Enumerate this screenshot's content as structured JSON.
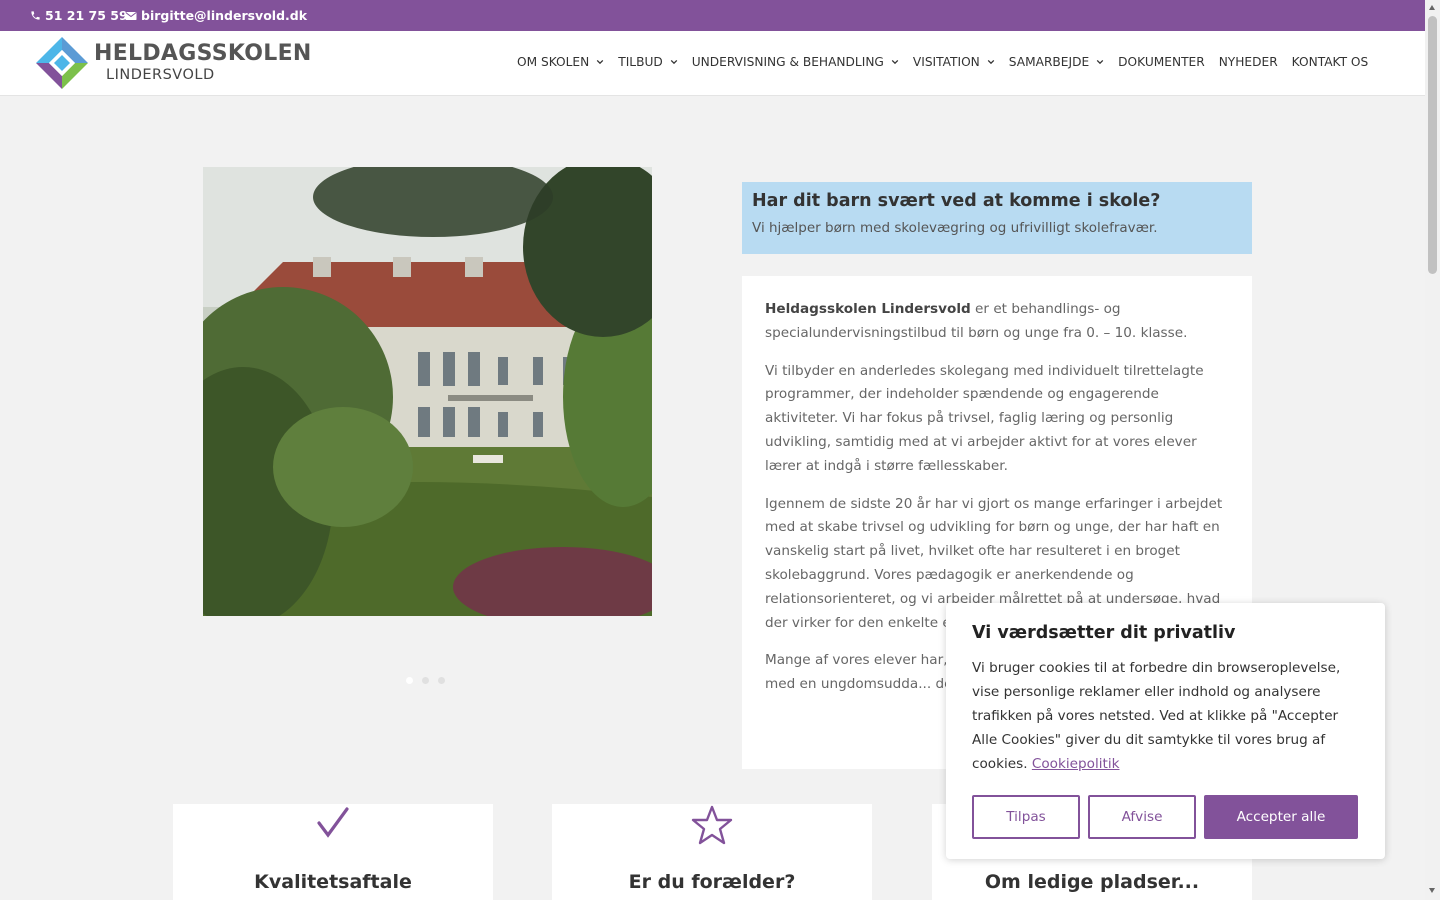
{
  "topbar": {
    "phone": "51 21 75 59",
    "email": "birgitte@lindersvold.dk",
    "phone_icon": "phone-icon",
    "email_icon": "envelope-icon",
    "background": "#82529a"
  },
  "header": {
    "logo_title": "HELDAGSSKOLEN",
    "logo_subtitle": "LINDERSVOLD",
    "logo_icon": "diamond-logo-icon",
    "nav": [
      {
        "label": "OM SKOLEN",
        "dropdown": true
      },
      {
        "label": "TILBUD",
        "dropdown": true
      },
      {
        "label": "UNDERVISNING & BEHANDLING",
        "dropdown": true
      },
      {
        "label": "VISITATION",
        "dropdown": true
      },
      {
        "label": "SAMARBEJDE",
        "dropdown": true
      },
      {
        "label": "DOKUMENTER",
        "dropdown": false
      },
      {
        "label": "NYHEDER",
        "dropdown": false
      },
      {
        "label": "KONTAKT OS",
        "dropdown": false
      }
    ]
  },
  "slider": {
    "image": "manor-building-photo",
    "dots": 3,
    "active_dot": 1
  },
  "banner": {
    "title": "Har dit barn svært ved at komme i skole?",
    "subtitle": "Vi hjælper børn med skolevægring og ufrivilligt skolefravær.",
    "background": "#b8dbf2"
  },
  "intro": {
    "p1_strong": "Heldagsskolen Lindersvold",
    "p1_rest": " er et behandlings- og specialundervisningstilbud til børn og unge fra 0. – 10. klasse.",
    "p2": "Vi tilbyder en anderledes skolegang med individuelt tilrettelagte programmer, der indeholder spændende og engagerende aktiviteter. Vi har fokus på trivsel, faglig læring og personlig udvikling, samtidig med at vi arbejder aktivt for at vores elever lærer at indgå i større fællesskaber.",
    "p3": "Igennem de sidste 20 år har vi gjort os mange erfaringer i arbejdet med at skabe trivsel og udvikling for børn og unge, der har haft en vanskelig start på livet, hvilket ofte har resulteret i en broget skolebaggrund. Vores pædagogik er anerkendende og relationsorienteret, og vi arbejder målrettet på at undersøge, hvad der virker for den enkelte elev.",
    "p4": "Mange af vores elever har, g... fået taget deres 9. klasses a... gang med en ungdomsudda... dem, når de skal skabe sig e..."
  },
  "cards": [
    {
      "title": "Kvalitetsaftale",
      "icon": "checkmark-icon"
    },
    {
      "title": "Er du forælder?",
      "icon": "star-icon"
    },
    {
      "title": "Om ledige pladser...",
      "icon": ""
    }
  ],
  "cookie": {
    "title": "Vi værdsætter dit privatliv",
    "message": "Vi bruger cookies til at forbedre din browseroplevelse, vise personlige reklamer eller indhold og analysere trafikken på vores netsted. Ved at klikke på \"Accepter Alle Cookies\" giver du dit samtykke til vores brug af cookies.",
    "link": "Cookiepolitik",
    "btn_customize": "Tilpas",
    "btn_reject": "Afvise",
    "btn_accept": "Accepter alle",
    "accent": "#82529a"
  }
}
